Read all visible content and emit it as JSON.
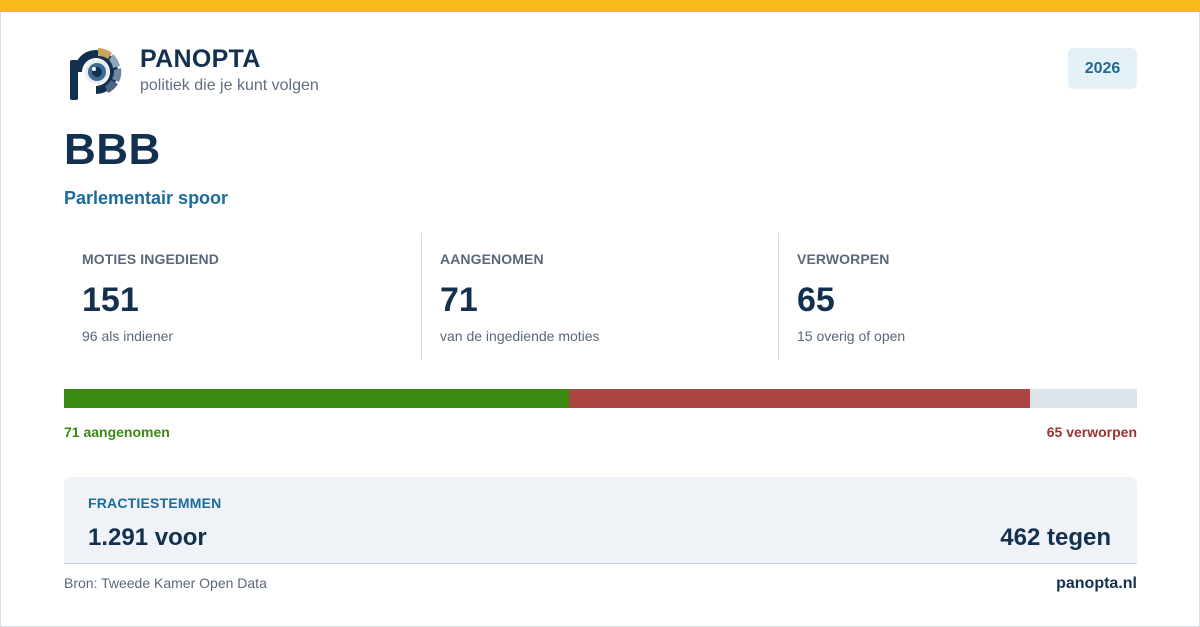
{
  "brand": {
    "name": "PANOPTA",
    "tagline": "politiek die je kunt volgen",
    "year": "2026",
    "logo_icon": "eye-p-logo-icon",
    "colors": {
      "stripe": "#fbb81c",
      "navy": "#13314f",
      "blue": "#1a6c9b"
    }
  },
  "party": {
    "name": "BBB",
    "subtitle": "Parlementair spoor"
  },
  "stats": [
    {
      "label": "MOTIES INGEDIEND",
      "value": "151",
      "sub": "96 als indiener"
    },
    {
      "label": "AANGENOMEN",
      "value": "71",
      "sub": "van de ingediende moties"
    },
    {
      "label": "VERWORPEN",
      "value": "65",
      "sub": "15 overig of open"
    }
  ],
  "outcome_bar": {
    "total": 151,
    "segments": [
      {
        "name": "aangenomen",
        "value": 71,
        "color": "#3b8a10"
      },
      {
        "name": "verworpen",
        "value": 65,
        "color": "#ac4444"
      },
      {
        "name": "overig",
        "value": 15,
        "color": "#dde3ea"
      }
    ],
    "left_label": "71 aangenomen",
    "right_label": "65 verworpen"
  },
  "votes": {
    "label": "FRACTIESTEMMEN",
    "for": "1.291 voor",
    "against": "462 tegen"
  },
  "footer": {
    "source": "Bron: Tweede Kamer Open Data",
    "site": "panopta.nl"
  }
}
